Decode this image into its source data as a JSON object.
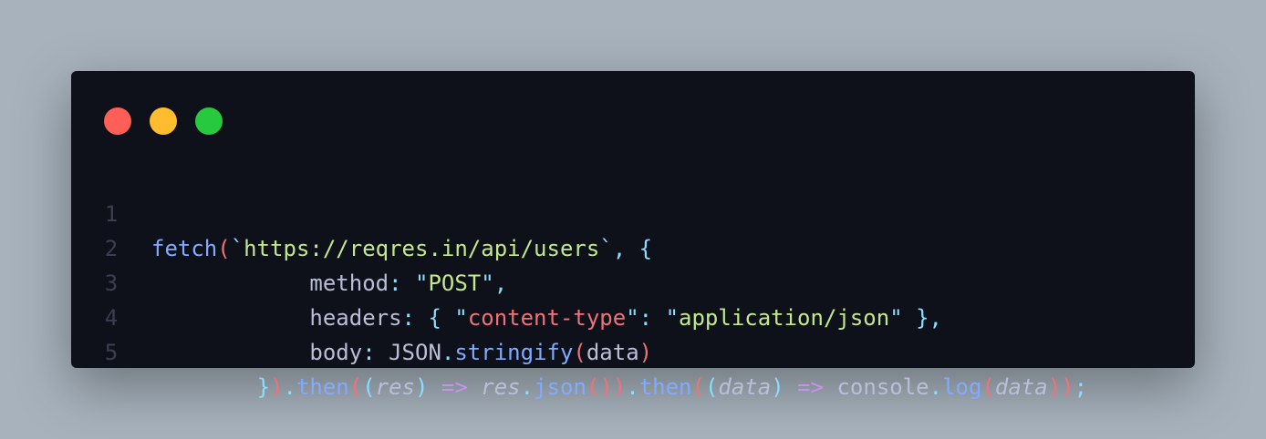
{
  "window": {
    "traffic_lights": {
      "close_color": "#ff5f56",
      "minimize_color": "#ffbd2e",
      "maximize_color": "#27c93f"
    }
  },
  "editor": {
    "lines": [
      {
        "number": "1",
        "tokens": [
          {
            "text": "fetch",
            "color": "#82aaff"
          },
          {
            "text": "(",
            "color": "#f07178"
          },
          {
            "text": "`",
            "color": "#89ddff"
          },
          {
            "text": "https://reqres.in/api/users",
            "color": "#c3e88d"
          },
          {
            "text": "`",
            "color": "#89ddff"
          },
          {
            "text": ", ",
            "color": "#89ddff"
          },
          {
            "text": "{",
            "color": "#89ddff"
          }
        ]
      },
      {
        "number": "2",
        "tokens": [
          {
            "text": "            method",
            "color": "#babed8"
          },
          {
            "text": ": ",
            "color": "#89ddff"
          },
          {
            "text": "\"",
            "color": "#89ddff"
          },
          {
            "text": "POST",
            "color": "#c3e88d"
          },
          {
            "text": "\"",
            "color": "#89ddff"
          },
          {
            "text": ",",
            "color": "#89ddff"
          }
        ]
      },
      {
        "number": "3",
        "tokens": [
          {
            "text": "            headers",
            "color": "#babed8"
          },
          {
            "text": ": ",
            "color": "#89ddff"
          },
          {
            "text": "{ ",
            "color": "#89ddff"
          },
          {
            "text": "\"",
            "color": "#89ddff"
          },
          {
            "text": "content-type",
            "color": "#f07178"
          },
          {
            "text": "\"",
            "color": "#89ddff"
          },
          {
            "text": ": ",
            "color": "#89ddff"
          },
          {
            "text": "\"",
            "color": "#89ddff"
          },
          {
            "text": "application/json",
            "color": "#c3e88d"
          },
          {
            "text": "\"",
            "color": "#89ddff"
          },
          {
            "text": " },",
            "color": "#89ddff"
          }
        ]
      },
      {
        "number": "4",
        "tokens": [
          {
            "text": "            body",
            "color": "#babed8"
          },
          {
            "text": ": ",
            "color": "#89ddff"
          },
          {
            "text": "JSON",
            "color": "#babed8"
          },
          {
            "text": ".",
            "color": "#89ddff"
          },
          {
            "text": "stringify",
            "color": "#82aaff"
          },
          {
            "text": "(",
            "color": "#f07178"
          },
          {
            "text": "data",
            "color": "#babed8"
          },
          {
            "text": ")",
            "color": "#f07178"
          }
        ]
      },
      {
        "number": "5",
        "tokens": [
          {
            "text": "        }",
            "color": "#89ddff"
          },
          {
            "text": ")",
            "color": "#f07178"
          },
          {
            "text": ".",
            "color": "#89ddff"
          },
          {
            "text": "then",
            "color": "#82aaff"
          },
          {
            "text": "(",
            "color": "#f07178"
          },
          {
            "text": "(",
            "color": "#89ddff"
          },
          {
            "text": "res",
            "color": "#babed8",
            "italic": true
          },
          {
            "text": ")",
            "color": "#89ddff"
          },
          {
            "text": " ",
            "color": "#babed8"
          },
          {
            "text": "=>",
            "color": "#c792ea"
          },
          {
            "text": " ",
            "color": "#babed8"
          },
          {
            "text": "res",
            "color": "#babed8",
            "italic": true
          },
          {
            "text": ".",
            "color": "#89ddff"
          },
          {
            "text": "json",
            "color": "#82aaff"
          },
          {
            "text": "()",
            "color": "#f07178"
          },
          {
            "text": ")",
            "color": "#f07178"
          },
          {
            "text": ".",
            "color": "#89ddff"
          },
          {
            "text": "then",
            "color": "#82aaff"
          },
          {
            "text": "(",
            "color": "#f07178"
          },
          {
            "text": "(",
            "color": "#89ddff"
          },
          {
            "text": "data",
            "color": "#babed8",
            "italic": true
          },
          {
            "text": ")",
            "color": "#89ddff"
          },
          {
            "text": " ",
            "color": "#babed8"
          },
          {
            "text": "=>",
            "color": "#c792ea"
          },
          {
            "text": " ",
            "color": "#babed8"
          },
          {
            "text": "console",
            "color": "#babed8"
          },
          {
            "text": ".",
            "color": "#89ddff"
          },
          {
            "text": "log",
            "color": "#82aaff"
          },
          {
            "text": "(",
            "color": "#f07178"
          },
          {
            "text": "data",
            "color": "#babed8",
            "italic": true
          },
          {
            "text": ")",
            "color": "#f07178"
          },
          {
            "text": ")",
            "color": "#f07178"
          },
          {
            "text": ";",
            "color": "#89ddff"
          }
        ]
      }
    ]
  }
}
